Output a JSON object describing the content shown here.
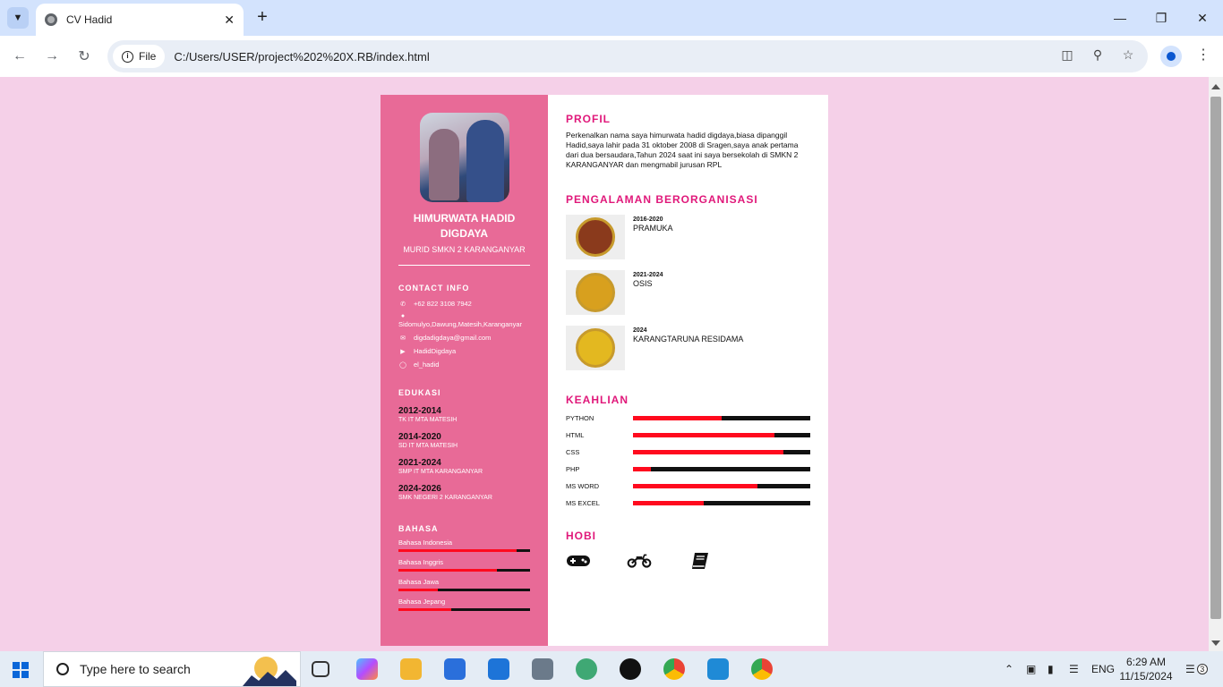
{
  "browser": {
    "tab_title": "CV Hadid",
    "url_chip": "File",
    "url": "C:/Users/USER/project%202%20X.RB/index.html"
  },
  "cv": {
    "name": "HIMURWATA HADID DIGDAYA",
    "role": "MURID SMKN 2 KARANGANYAR",
    "contact": {
      "title": "CONTACT INFO",
      "phone": "+62 822 3108 7942",
      "address": "Sidomulyo,Dawung,Matesih,Karanganyar",
      "email": "digdadigdaya@gmail.com",
      "youtube": "HadidDigdaya",
      "instagram": "el_hadid"
    },
    "education": {
      "title": "EDUKASI",
      "items": [
        {
          "year": "2012-2014",
          "school": "TK IT MTA MATESIH"
        },
        {
          "year": "2014-2020",
          "school": "SD IT MTA MATESIH"
        },
        {
          "year": "2021-2024",
          "school": "SMP IT MTA KARANGANYAR"
        },
        {
          "year": "2024-2026",
          "school": "SMK NEGERI 2 KARANGANYAR"
        }
      ]
    },
    "languages": {
      "title": "BAHASA",
      "items": [
        {
          "name": "Bahasa Indonesia",
          "level": 0.9
        },
        {
          "name": "Bahasa Inggris",
          "level": 0.75
        },
        {
          "name": "Bahasa Jawa",
          "level": 0.3
        },
        {
          "name": "Bahasa Jepang",
          "level": 0.4
        }
      ]
    },
    "profile": {
      "title": "PROFIL",
      "text": "Perkenalkan nama saya himurwata hadid digdaya,biasa dipanggil Hadid,saya lahir pada 31 oktober 2008 di Sragen,saya anak pertama dari dua bersaudara,Tahun 2024 saat ini saya bersekolah di SMKN 2 KARANGANYAR dan mengmabil jurusan RPL"
    },
    "organizations": {
      "title": "PENGALAMAN BERORGANISASI",
      "items": [
        {
          "year": "2016-2020",
          "name": "PRAMUKA",
          "color": "#8a3a1c"
        },
        {
          "year": "2021-2024",
          "name": "OSIS",
          "color": "#d8a01e"
        },
        {
          "year": "2024",
          "name": "KARANGTARUNA RESIDAMA",
          "color": "#e3b820"
        }
      ]
    },
    "skills": {
      "title": "KEAHLIAN",
      "items": [
        {
          "name": "PYTHON",
          "level": 0.5
        },
        {
          "name": "HTML",
          "level": 0.8
        },
        {
          "name": "CSS",
          "level": 0.85
        },
        {
          "name": "PHP",
          "level": 0.1
        },
        {
          "name": "MS WORD",
          "level": 0.7
        },
        {
          "name": "MS EXCEL",
          "level": 0.4
        }
      ]
    },
    "hobbies": {
      "title": "HOBI",
      "items": [
        "gamepad-icon",
        "motorcycle-icon",
        "book-icon"
      ]
    }
  },
  "taskbar": {
    "search_placeholder": "Type here to search",
    "time": "6:29 AM",
    "date": "11/15/2024",
    "lang": "ENG",
    "notif_count": "3"
  },
  "colors": {
    "sidebar": "#e86a97",
    "accent": "#e0187a",
    "bar_fill": "#ff0a1e",
    "bar_bg": "#111111",
    "page_bg": "#f5d0e8"
  }
}
